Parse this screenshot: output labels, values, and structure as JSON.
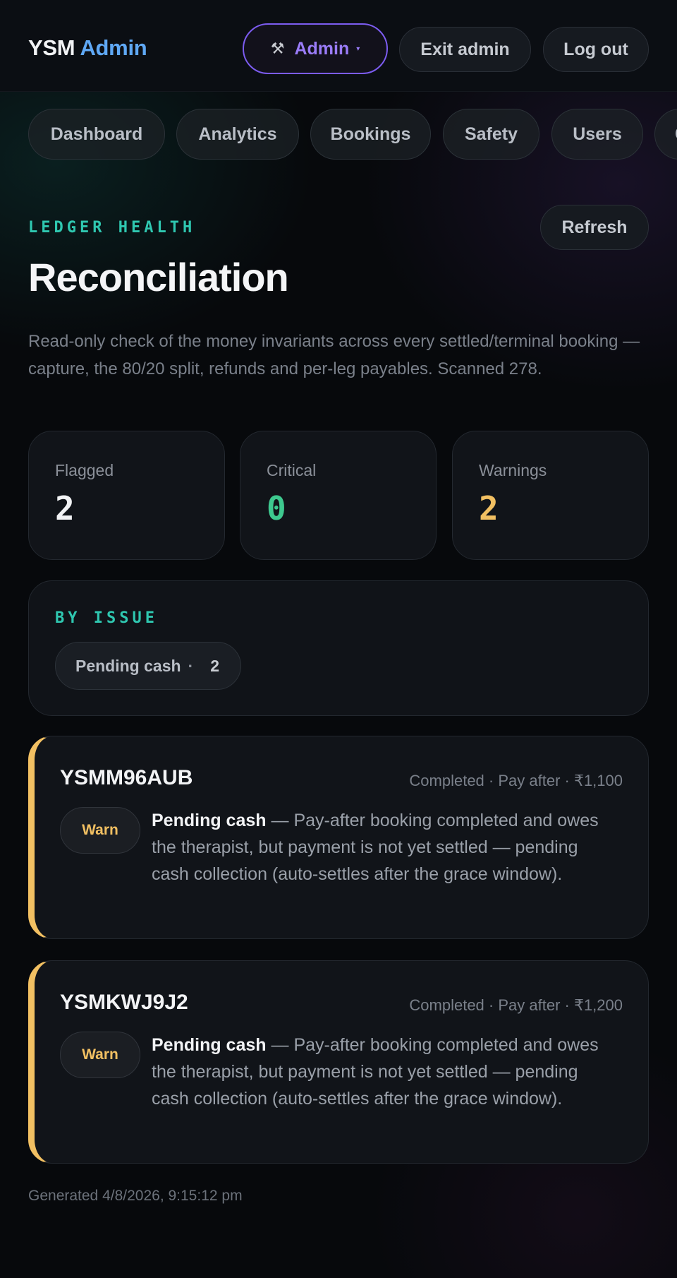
{
  "header": {
    "brand_part1": "YSM",
    "brand_part2": "Admin",
    "admin_tool_icon": "⚒",
    "admin_label": "Admin",
    "admin_caret": "▾",
    "exit_label": "Exit admin",
    "logout_label": "Log out"
  },
  "nav": {
    "tabs": [
      {
        "label": "Dashboard"
      },
      {
        "label": "Analytics"
      },
      {
        "label": "Bookings"
      },
      {
        "label": "Safety"
      },
      {
        "label": "Users"
      },
      {
        "label": "C"
      }
    ]
  },
  "section": {
    "eyebrow": "LEDGER HEALTH",
    "refresh_label": "Refresh",
    "title": "Reconciliation",
    "description": "Read-only check of the money invariants across every settled/terminal booking — capture, the 80/20 split, refunds and per-leg payables. Scanned 278."
  },
  "stats": [
    {
      "label": "Flagged",
      "value": "2",
      "color": "#f2f3f5"
    },
    {
      "label": "Critical",
      "value": "0",
      "color": "#3ec98f"
    },
    {
      "label": "Warnings",
      "value": "2",
      "color": "#f2c062"
    }
  ],
  "by_issue": {
    "eyebrow": "BY ISSUE",
    "chips": [
      {
        "label": "Pending cash",
        "sep": "·",
        "count": "2"
      }
    ]
  },
  "rows": [
    {
      "code": "YSMM96AUB",
      "meta": "Completed · Pay after · ₹1,100",
      "badge": "Warn",
      "issue": "Pending cash",
      "detail": " — Pay-after booking completed and owes the therapist, but payment is not yet settled — pending cash collection (auto-settles after the grace window)."
    },
    {
      "code": "YSMKWJ9J2",
      "meta": "Completed · Pay after · ₹1,200",
      "badge": "Warn",
      "issue": "Pending cash",
      "detail": " — Pay-after booking completed and owes the therapist, but payment is not yet settled — pending cash collection (auto-settles after the grace window)."
    }
  ],
  "footer": {
    "generated": "Generated 4/8/2026, 9:15:12 pm"
  },
  "colors": {
    "accent_teal": "#2fc7b0",
    "accent_purple": "#7c5cf0",
    "brand_blue": "#5fa8f5",
    "warn": "#f2c062",
    "ok": "#3ec98f"
  }
}
